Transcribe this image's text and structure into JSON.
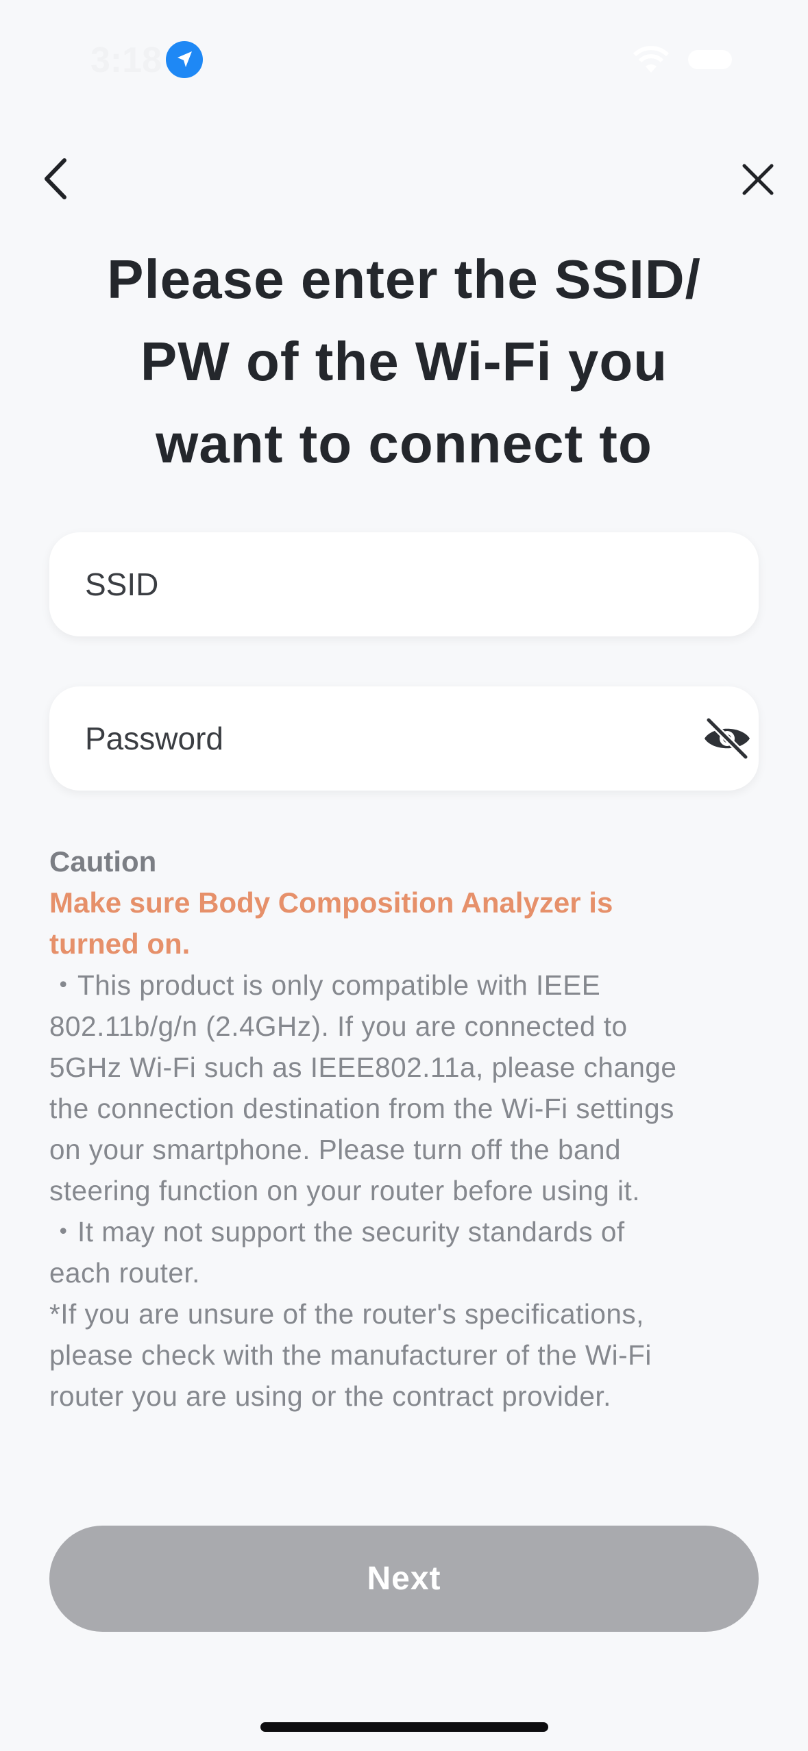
{
  "status_bar": {
    "time": "3:18",
    "icons": [
      "location-arrow-icon",
      "wifi-icon",
      "battery-icon"
    ]
  },
  "nav": {
    "back_icon": "chevron-left-icon",
    "close_icon": "close-icon"
  },
  "title": {
    "line1": "Please enter the SSID/",
    "line2": "PW of the Wi-Fi you",
    "line3": "want to connect to"
  },
  "form": {
    "ssid": {
      "value": "",
      "placeholder": "SSID"
    },
    "password": {
      "value": "",
      "placeholder": "Password",
      "toggle_icon": "eye-off-icon"
    }
  },
  "caution": {
    "heading": "Caution",
    "warning_line1": "Make sure Body Composition Analyzer is",
    "warning_line2": "turned on.",
    "body_lines": [
      "・This product is only compatible with IEEE",
      "802.11b/g/n (2.4GHz). If you are connected to",
      "5GHz Wi-Fi such as IEEE802.11a, please change",
      "the connection destination from the Wi-Fi settings",
      "on your smartphone. Please turn off the band",
      "steering function on your router before using it.",
      "・It may not support the security standards of",
      "each router.",
      "*If you are unsure of the router's specifications,",
      "please check with the manufacturer of the Wi-Fi",
      "router you are using or the contract provider."
    ]
  },
  "actions": {
    "next_label": "Next"
  },
  "colors": {
    "background": "#f7f8fa",
    "warning": "#e6906a",
    "button_disabled": "#a9aaae",
    "location_badge": "#1e88f5"
  }
}
